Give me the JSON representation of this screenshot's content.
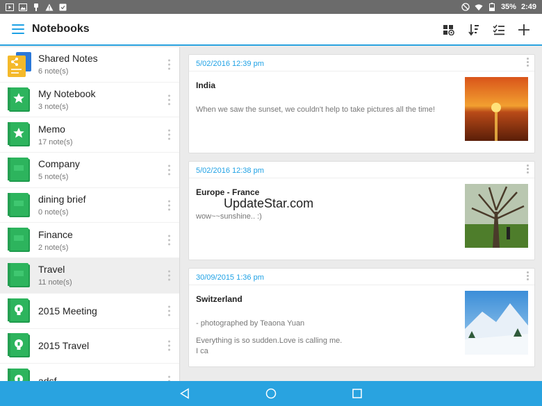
{
  "status_bar": {
    "battery": "35%",
    "time": "2:49"
  },
  "app_bar": {
    "title": "Notebooks",
    "menu_icon": "hamburger-menu-icon",
    "actions": [
      "grid-view-icon",
      "sort-icon",
      "checklist-icon",
      "add-icon"
    ]
  },
  "notebooks": [
    {
      "name": "Shared Notes",
      "count": "6 note(s)",
      "icon": "shared-notebook-icon"
    },
    {
      "name": "My Notebook",
      "count": "3 note(s)",
      "icon": "star-notebook-icon"
    },
    {
      "name": "Memo",
      "count": "17 note(s)",
      "icon": "star-notebook-icon"
    },
    {
      "name": "Company",
      "count": "5 note(s)",
      "icon": "notebook-icon"
    },
    {
      "name": "dining brief",
      "count": "0 note(s)",
      "icon": "notebook-icon"
    },
    {
      "name": "Finance",
      "count": "2 note(s)",
      "icon": "notebook-icon"
    },
    {
      "name": "Travel",
      "count": "11 note(s)",
      "icon": "notebook-icon",
      "selected": true
    },
    {
      "name": "2015 Meeting",
      "count": "",
      "icon": "bulb-notebook-icon"
    },
    {
      "name": "2015 Travel",
      "count": "",
      "icon": "bulb-notebook-icon"
    },
    {
      "name": "adsf",
      "count": "",
      "icon": "bulb-notebook-icon"
    }
  ],
  "notes": [
    {
      "date": "5/02/2016 12:39 pm",
      "title": "India",
      "body": "When we saw the sunset, we couldn't help to take pictures all the time!",
      "body2": "",
      "thumb": "sunset-over-sea-photo"
    },
    {
      "date": "5/02/2016 12:38 pm",
      "title": "Europe - France",
      "body": "wow~~sunshine.. :)",
      "body2": "",
      "thumb": "tree-in-park-photo"
    },
    {
      "date": "30/09/2015 1:36 pm",
      "title": "Switzerland",
      "body": "- photographed by Teaona Yuan",
      "body2": "Everything is so sudden.Love is calling me.\nI ca",
      "thumb": "snowy-mountains-photo"
    }
  ],
  "watermark": "UpdateStar.com",
  "nav_bar": [
    "back-icon",
    "home-icon",
    "recents-icon"
  ],
  "colors": {
    "accent": "#29a3e0",
    "notebook_green": "#2db45d",
    "shared_yellow": "#f4b92b"
  }
}
